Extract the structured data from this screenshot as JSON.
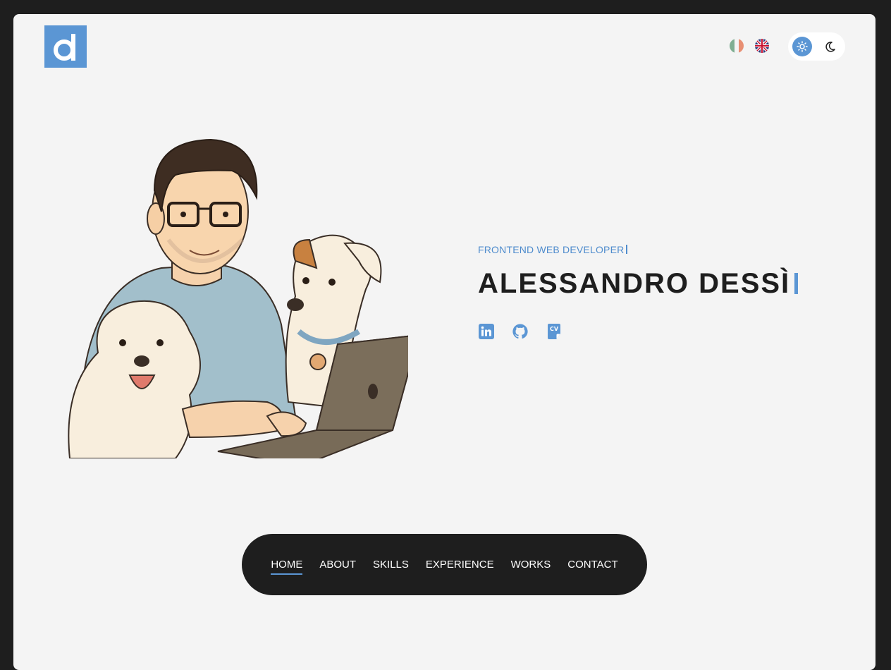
{
  "header": {
    "logo_icon": "brand-d-logo",
    "languages": [
      {
        "code": "it",
        "icon": "italy-flag-icon"
      },
      {
        "code": "en",
        "icon": "uk-flag-icon"
      }
    ],
    "theme_toggle": {
      "options": [
        "light",
        "dark"
      ],
      "active": "light"
    }
  },
  "hero": {
    "subtitle": "FRONTEND WEB DEVELOPER",
    "name": "ALESSANDRO DESSÌ",
    "illustration": "developer-with-dogs-illustration",
    "socials": [
      {
        "icon": "linkedin-icon"
      },
      {
        "icon": "github-icon"
      },
      {
        "icon": "cv-icon"
      }
    ]
  },
  "nav": {
    "items": [
      "HOME",
      "ABOUT",
      "SKILLS",
      "EXPERIENCE",
      "WORKS",
      "CONTACT"
    ],
    "active": "HOME"
  },
  "colors": {
    "accent": "#5b96d4",
    "background": "#f4f4f4",
    "outer": "#1e1e1e",
    "text": "#1e1e1e"
  }
}
